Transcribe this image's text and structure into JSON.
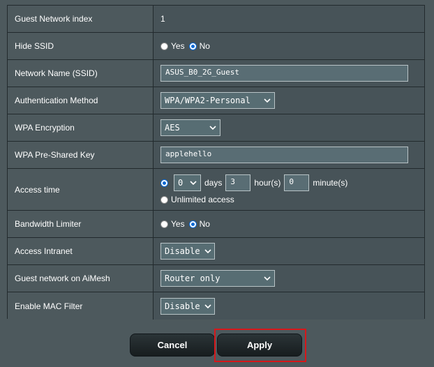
{
  "rows": [
    {
      "label": "Guest Network index",
      "value": "1"
    },
    {
      "label": "Hide SSID",
      "options": [
        "Yes",
        "No"
      ],
      "selected": "No"
    },
    {
      "label": "Network Name (SSID)",
      "value": "ASUS_B0_2G_Guest"
    },
    {
      "label": "Authentication Method",
      "value": "WPA/WPA2-Personal"
    },
    {
      "label": "WPA Encryption",
      "value": "AES"
    },
    {
      "label": "WPA Pre-Shared Key",
      "value": "applehello"
    },
    {
      "label": "Access time",
      "days": "0",
      "days_label": "days",
      "hours": "3",
      "hours_label": "hour(s)",
      "minutes": "0",
      "minutes_label": "minute(s)",
      "unlimited_label": "Unlimited access"
    },
    {
      "label": "Bandwidth Limiter",
      "options": [
        "Yes",
        "No"
      ],
      "selected": "No"
    },
    {
      "label": "Access Intranet",
      "value": "Disable"
    },
    {
      "label": "Guest network on AiMesh",
      "value": "Router only"
    },
    {
      "label": "Enable MAC Filter",
      "value": "Disable"
    }
  ],
  "buttons": {
    "cancel": "Cancel",
    "apply": "Apply"
  },
  "colors": {
    "background": "#4d595d",
    "accent": "#0a69d6",
    "highlight": "#d7171a"
  }
}
